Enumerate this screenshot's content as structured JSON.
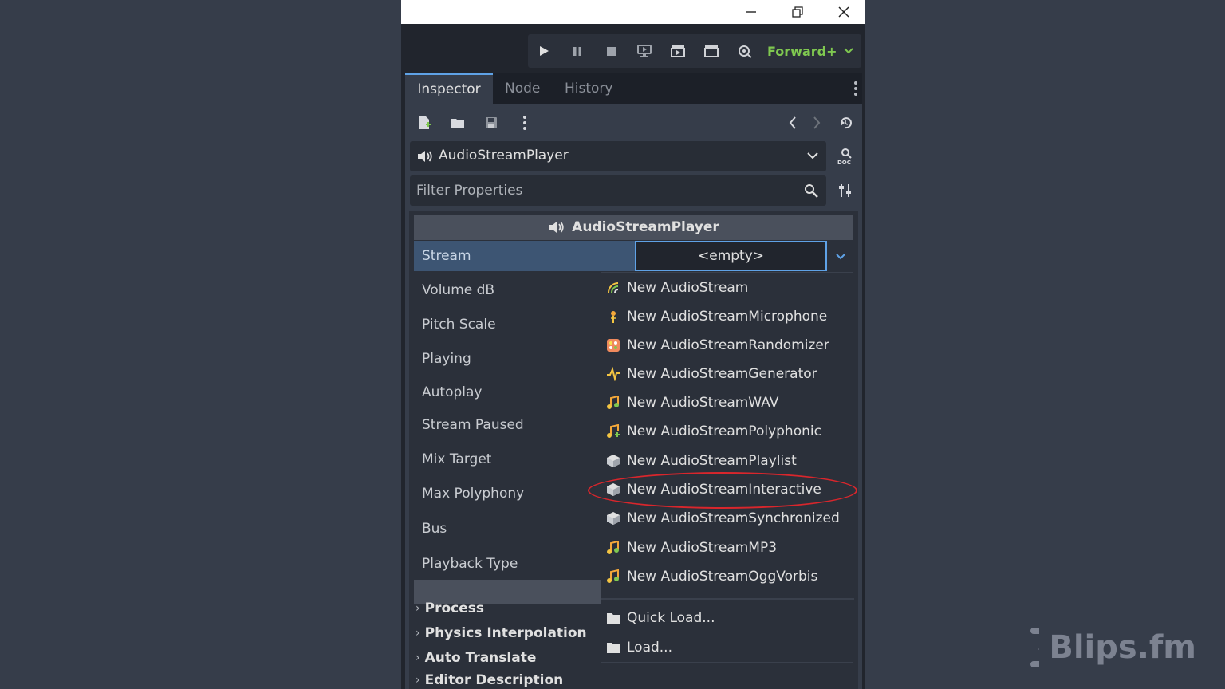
{
  "titlebar": {
    "minimize_icon": "minimize-icon",
    "restore_icon": "restore-icon",
    "close_icon": "close-icon"
  },
  "toolbar": {
    "renderer_label": "Forward+",
    "buttons": [
      "play-icon",
      "pause-icon",
      "stop-icon",
      "remote-debug-icon",
      "movie-maker-icon",
      "movie-maker-alt-icon",
      "debug-icon"
    ]
  },
  "tabs": [
    {
      "label": "Inspector",
      "active": true
    },
    {
      "label": "Node",
      "active": false
    },
    {
      "label": "History",
      "active": false
    }
  ],
  "inspector": {
    "object_name": "AudioStreamPlayer",
    "filter_placeholder": "Filter Properties",
    "section_title": "AudioStreamPlayer",
    "stream_value": "<empty>",
    "properties": [
      "Stream",
      "Volume dB",
      "Pitch Scale",
      "Playing",
      "Autoplay",
      "Stream Paused",
      "Mix Target",
      "Max Polyphony",
      "Bus",
      "Playback Type"
    ],
    "groups": [
      "Process",
      "Physics Interpolation",
      "Auto Translate",
      "Editor Description"
    ]
  },
  "popup": {
    "items": [
      {
        "label": "New AudioStream",
        "icon": "audiostream-icon"
      },
      {
        "label": "New AudioStreamMicrophone",
        "icon": "microphone-icon"
      },
      {
        "label": "New AudioStreamRandomizer",
        "icon": "randomizer-icon"
      },
      {
        "label": "New AudioStreamGenerator",
        "icon": "generator-icon"
      },
      {
        "label": "New AudioStreamWAV",
        "icon": "wav-icon"
      },
      {
        "label": "New AudioStreamPolyphonic",
        "icon": "polyphonic-icon"
      },
      {
        "label": "New AudioStreamPlaylist",
        "icon": "cube-icon"
      },
      {
        "label": "New AudioStreamInteractive",
        "icon": "cube-icon",
        "highlighted": true
      },
      {
        "label": "New AudioStreamSynchronized",
        "icon": "cube-icon"
      },
      {
        "label": "New AudioStreamMP3",
        "icon": "mp3-icon"
      },
      {
        "label": "New AudioStreamOggVorbis",
        "icon": "ogg-icon"
      }
    ],
    "load_items": [
      {
        "label": "Quick Load...",
        "icon": "folder-icon"
      },
      {
        "label": "Load...",
        "icon": "folder-icon"
      }
    ],
    "highlight_color": "#d9262c"
  },
  "watermark": {
    "text": "Blips.fm"
  },
  "colors": {
    "accent": "#5fa2e6",
    "renderer": "#7fc850",
    "background": "#363d4a"
  }
}
